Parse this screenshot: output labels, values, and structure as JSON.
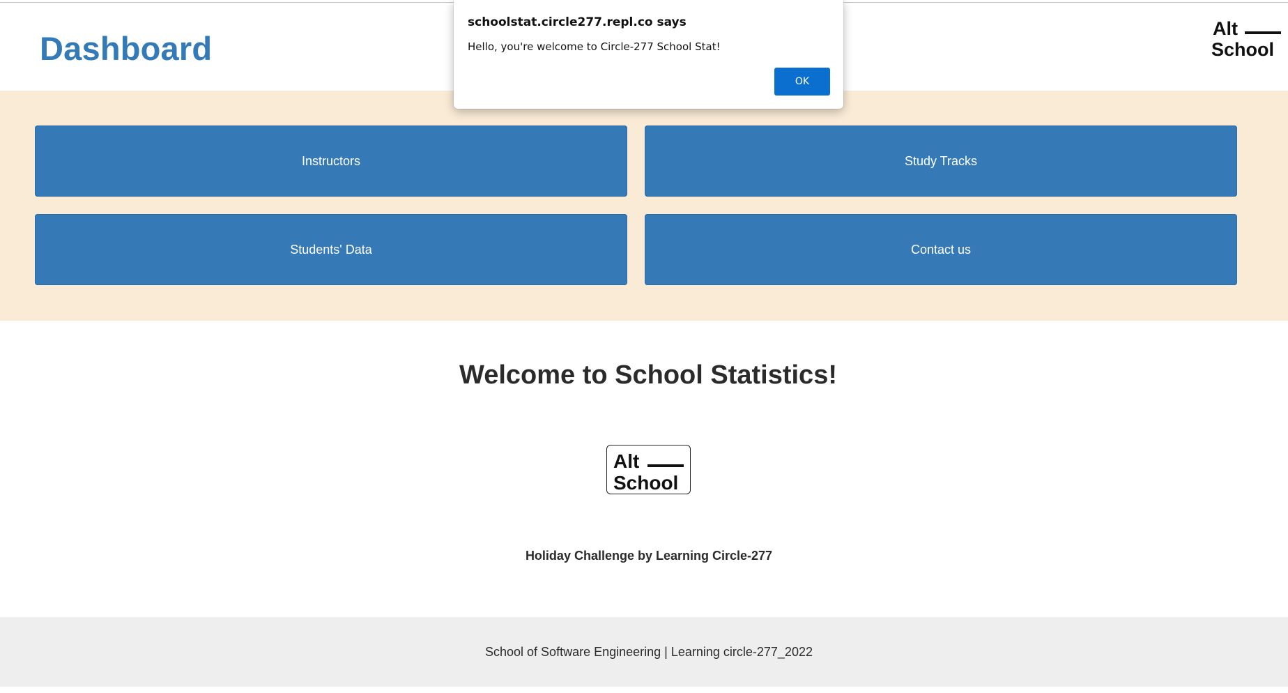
{
  "header": {
    "title": "Dashboard",
    "logo": {
      "line1": "Alt",
      "line2": "School"
    }
  },
  "nav": {
    "buttons": [
      {
        "label": "Instructors"
      },
      {
        "label": "Study Tracks"
      },
      {
        "label": "Students' Data"
      },
      {
        "label": "Contact us"
      }
    ]
  },
  "main": {
    "welcome": "Welcome to School Statistics!",
    "logo": {
      "line1": "Alt",
      "line2": "School"
    },
    "credit": "Holiday Challenge by Learning Circle-277"
  },
  "footer": {
    "text": "School of Software Engineering | Learning circle-277_2022"
  },
  "dialog": {
    "title": "schoolstat.circle277.repl.co says",
    "message": "Hello, you're welcome to Circle-277 School Stat!",
    "ok_label": "OK"
  },
  "colors": {
    "accent": "#337ab7",
    "nav_background": "#f9ebd6",
    "footer_background": "#eeeeee",
    "dialog_button": "#0b6fd0"
  }
}
